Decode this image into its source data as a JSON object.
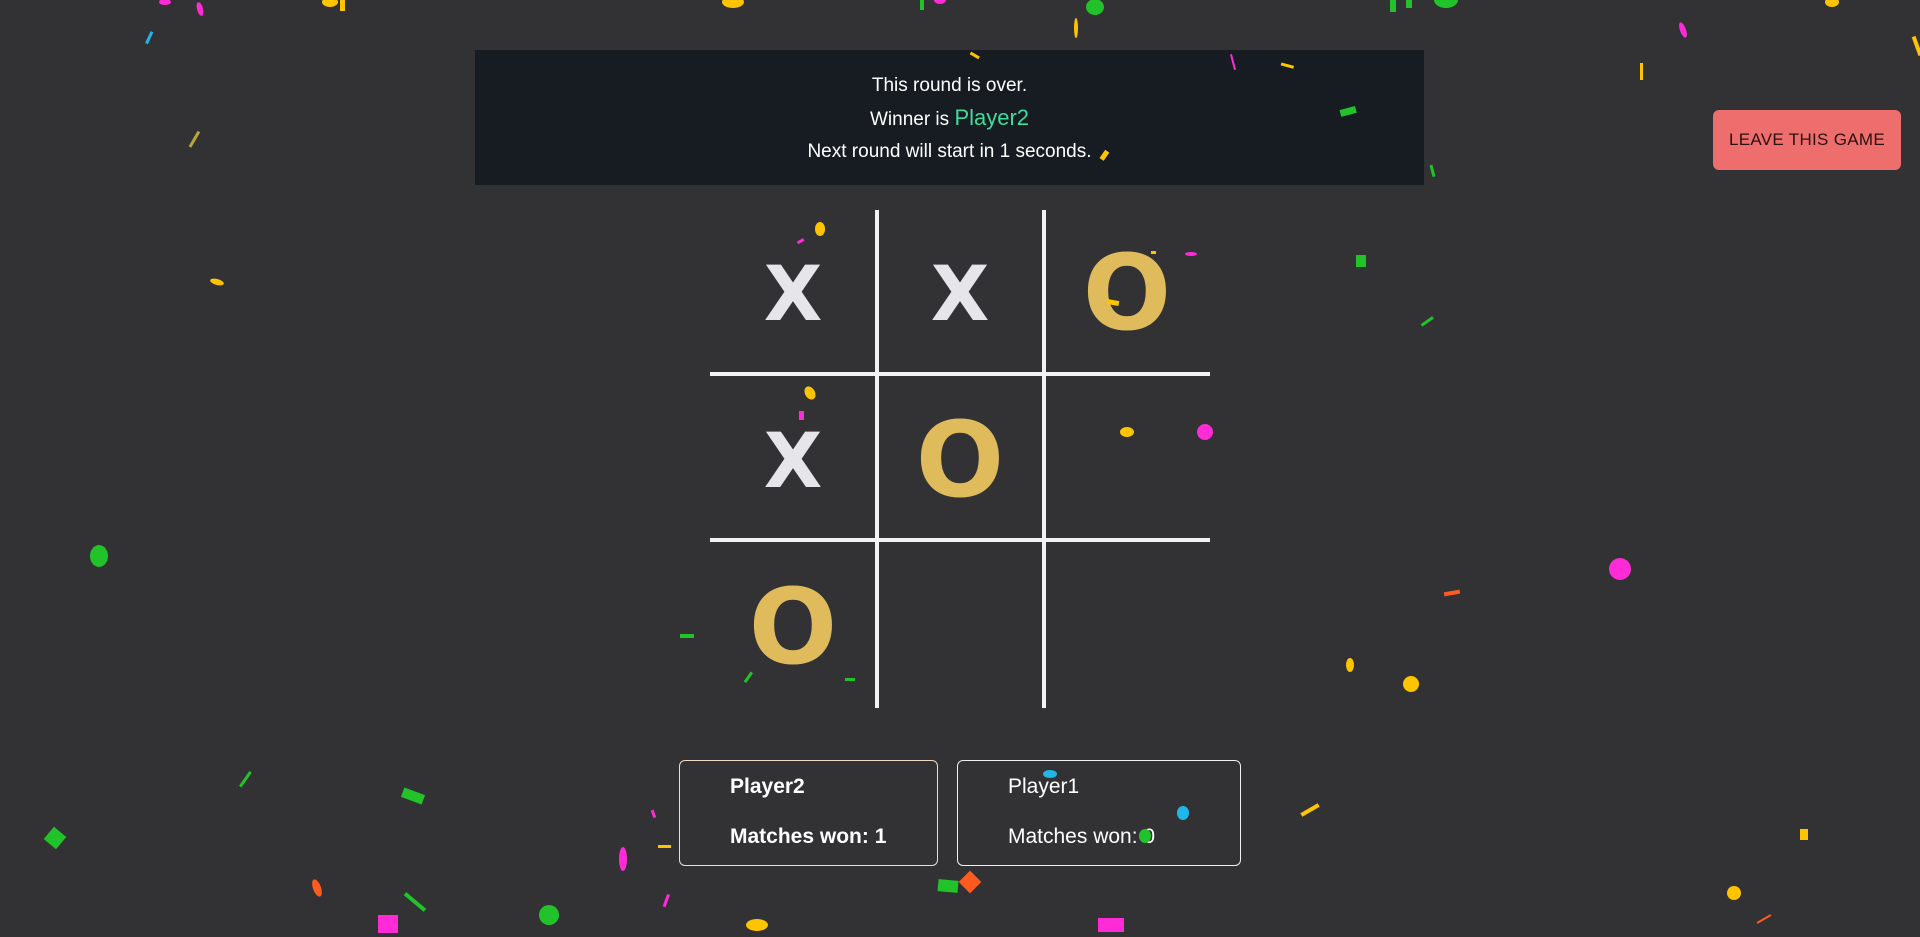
{
  "banner": {
    "line1": "This round is over.",
    "winner_prefix": "Winner is",
    "winner_name": "Player2",
    "line3": "Next round will start in 1 seconds."
  },
  "leave_button": {
    "label": "LEAVE THIS GAME"
  },
  "board": {
    "cells": [
      "X",
      "X",
      "O",
      "X",
      "O",
      "",
      "O",
      "",
      ""
    ]
  },
  "players": [
    {
      "name": "Player2",
      "matches_label": "Matches won:",
      "matches_won": "1",
      "active": true
    },
    {
      "name": "Player1",
      "matches_label": "Matches won:",
      "matches_won": "0",
      "active": false
    }
  ],
  "colors": {
    "background": "#323235",
    "banner_background": "#161c21",
    "winner_text": "#3fdc9a",
    "leave_button": "#ee6e6e",
    "x_mark": "#e6e6ea",
    "o_mark": "#dfbb5b",
    "grid": "#f2f2f2"
  }
}
